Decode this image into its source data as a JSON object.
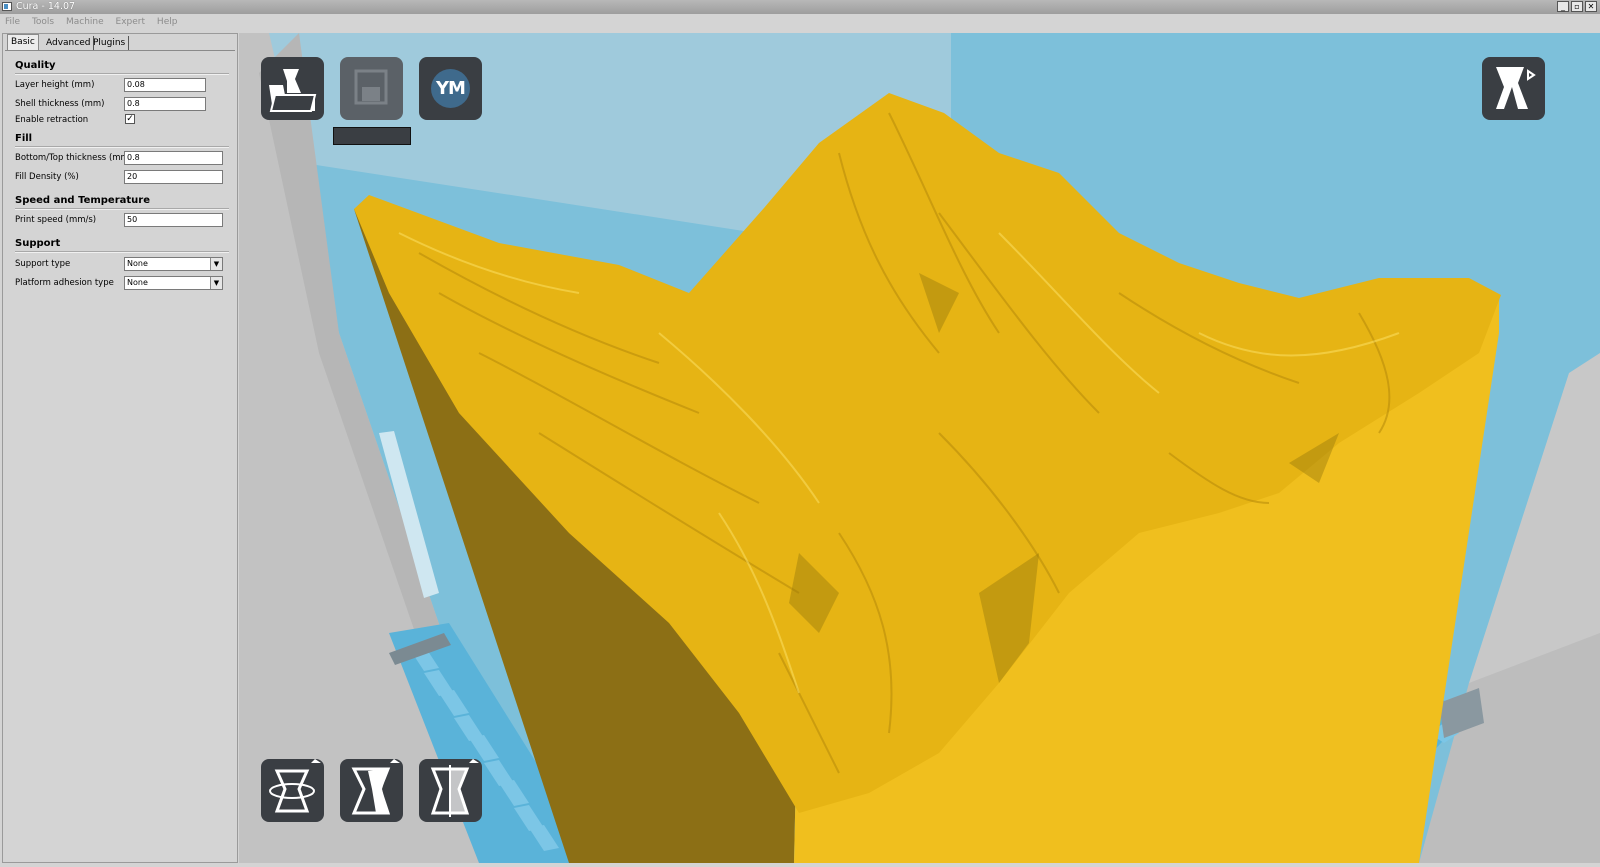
{
  "window": {
    "title": "Cura - 14.07",
    "buttons": {
      "minimize": "_",
      "maximize": "▫",
      "close": "✕"
    }
  },
  "menu": [
    "File",
    "Tools",
    "Machine",
    "Expert",
    "Help"
  ],
  "tabs": [
    "Basic",
    "Advanced",
    "Plugins"
  ],
  "sections": {
    "quality": {
      "title": "Quality",
      "layer_height_label": "Layer height (mm)",
      "layer_height_value": "0.08",
      "shell_thickness_label": "Shell thickness (mm)",
      "shell_thickness_value": "0.8",
      "retraction_label": "Enable retraction",
      "retraction_checked": true
    },
    "fill": {
      "title": "Fill",
      "bottom_top_label": "Bottom/Top thickness (mm)",
      "bottom_top_value": "0.8",
      "density_label": "Fill Density (%)",
      "density_value": "20"
    },
    "speed": {
      "title": "Speed and Temperature",
      "print_speed_label": "Print speed (mm/s)",
      "print_speed_value": "50"
    },
    "support": {
      "title": "Support",
      "support_type_label": "Support type",
      "support_type_value": "None",
      "adhesion_label": "Platform adhesion type",
      "adhesion_value": "None"
    }
  },
  "viewport": {
    "ym_label": "YM",
    "icons": [
      "load-icon",
      "save-icon",
      "youmagine-icon",
      "view-mode-icon",
      "rotate-icon",
      "scale-icon",
      "mirror-icon"
    ],
    "colors": {
      "sky": "#7dc0da",
      "back_wall_light": "#9fc9db",
      "grey_wall": "#c3c3c3",
      "model_left": "#8c6f15",
      "model_right": "#f0bf1e",
      "model_top": "#e6b414",
      "button_bg": "#3a3e43"
    }
  }
}
